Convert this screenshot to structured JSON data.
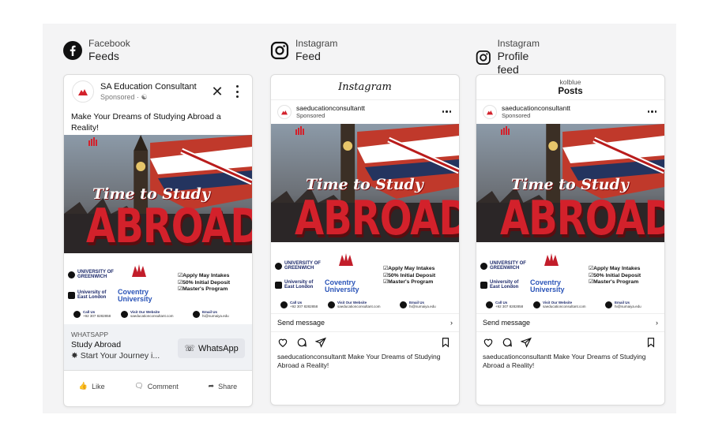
{
  "columns": [
    {
      "platform": "Facebook",
      "placement": "Feeds",
      "icon": "facebook-icon"
    },
    {
      "platform": "Instagram",
      "placement": "Feed",
      "icon": "instagram-icon"
    },
    {
      "platform": "Instagram",
      "placement": "Profile feed",
      "icon": "instagram-icon"
    }
  ],
  "fb": {
    "page_name": "SA Education Consultant",
    "sponsored": "Sponsored · ",
    "primary_text": "Make Your Dreams of Studying Abroad a Reality!",
    "cta_kicker": "WHATSAPP",
    "cta_headline": "Study Abroad",
    "cta_desc": "Start Your Journey i...",
    "cta_button": "WhatsApp",
    "actions": [
      "Like",
      "Comment",
      "Share"
    ]
  },
  "ig_feed": {
    "top_title": "Instagram",
    "handle": "saeducationconsultantt",
    "sponsored": "Sponsored",
    "send_message": "Send message",
    "caption_user": "saeducationconsultantt",
    "caption_text": "Make Your Dreams of Studying Abroad a Reality!"
  },
  "ig_profile": {
    "top_user": "kolblue",
    "top_title": "Posts",
    "handle": "saeducationconsultantt",
    "sponsored": "Sponsored",
    "send_message": "Send message",
    "caption_user": "saeducationconsultantt",
    "caption_text": "Make Your Dreams of Studying Abroad a Reality!"
  },
  "creative": {
    "script_title": "Time to Study",
    "big_title": "ABROAD",
    "universities": [
      "UNIVERSITY OF GREENWICH",
      "University of East London",
      "Coventry University"
    ],
    "benefits": [
      "Apply May Intakes",
      "50% Initial Deposit",
      "Master's Program"
    ],
    "contacts": [
      {
        "label": "Call Us",
        "value": "+92 307 8282858"
      },
      {
        "label": "Visit Our Website",
        "value": "saeducationconsultant.com"
      },
      {
        "label": "Email Us",
        "value": "hi@sumaiya.edu"
      }
    ]
  },
  "colors": {
    "brand_red": "#d3212b",
    "fb_blue": "#1877f2",
    "cta_bg": "#f0f2f5"
  }
}
